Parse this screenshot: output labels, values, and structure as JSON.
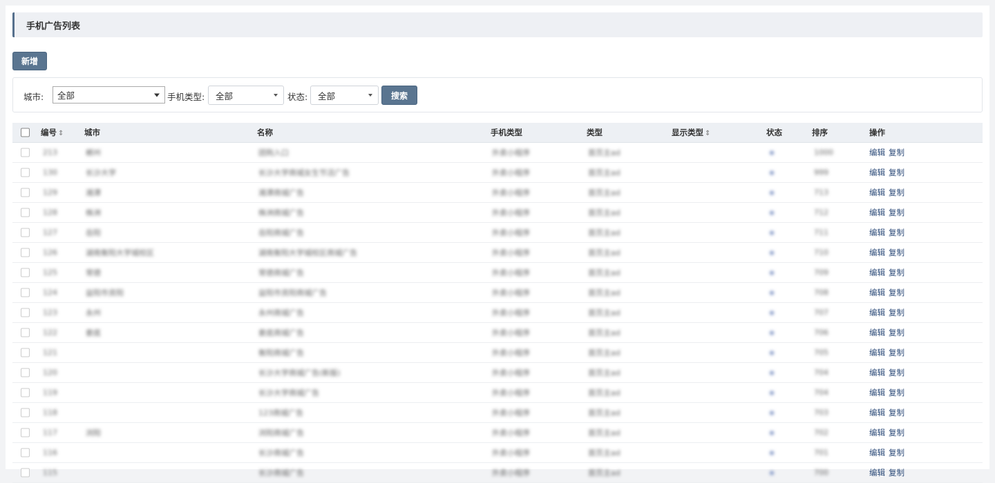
{
  "page": {
    "title": "手机广告列表",
    "add_label": "新增"
  },
  "filters": {
    "city_label": "城市:",
    "city_value": "全部",
    "phone_type_label": "手机类型:",
    "phone_type_value": "全部",
    "status_label": "状态:",
    "status_value": "全部",
    "search_label": "搜索"
  },
  "table": {
    "columns": [
      "编号",
      "城市",
      "名称",
      "手机类型",
      "类型",
      "显示类型",
      "状态",
      "排序",
      "操作"
    ],
    "sort_glyph": "⇕",
    "edit_label": "编辑",
    "copy_label": "复制",
    "rows": [
      {
        "id": "213",
        "city": "郴州",
        "name": "团购入口",
        "phone_type": "外卖小程序",
        "type": "首页主ad",
        "sort": "1000"
      },
      {
        "id": "130",
        "city": "长沙大学",
        "name": "长沙大学商城女生节活广告",
        "phone_type": "外卖小程序",
        "type": "首页主ad",
        "sort": "999"
      },
      {
        "id": "129",
        "city": "湘潭",
        "name": "湘潭商城广告",
        "phone_type": "外卖小程序",
        "type": "首页主ad",
        "sort": "713"
      },
      {
        "id": "128",
        "city": "株洲",
        "name": "株洲商城广告",
        "phone_type": "外卖小程序",
        "type": "首页主ad",
        "sort": "712"
      },
      {
        "id": "127",
        "city": "岳阳",
        "name": "岳阳商城广告",
        "phone_type": "外卖小程序",
        "type": "首页主ad",
        "sort": "711"
      },
      {
        "id": "126",
        "city": "湖南衡阳大学城校区",
        "name": "湖南衡阳大学城校区商城广告",
        "phone_type": "外卖小程序",
        "type": "首页主ad",
        "sort": "710"
      },
      {
        "id": "125",
        "city": "常德",
        "name": "常德商城广告",
        "phone_type": "外卖小程序",
        "type": "首页主ad",
        "sort": "709"
      },
      {
        "id": "124",
        "city": "益阳市资阳",
        "name": "益阳市资阳商城广告",
        "phone_type": "外卖小程序",
        "type": "首页主ad",
        "sort": "708"
      },
      {
        "id": "123",
        "city": "永州",
        "name": "永州商城广告",
        "phone_type": "外卖小程序",
        "type": "首页主ad",
        "sort": "707"
      },
      {
        "id": "122",
        "city": "娄底",
        "name": "娄底商城广告",
        "phone_type": "外卖小程序",
        "type": "首页主ad",
        "sort": "706"
      },
      {
        "id": "121",
        "city": "",
        "name": "衡阳商城广告",
        "phone_type": "外卖小程序",
        "type": "首页主ad",
        "sort": "705"
      },
      {
        "id": "120",
        "city": "",
        "name": "长沙大学商城广告(新版)",
        "phone_type": "外卖小程序",
        "type": "首页主ad",
        "sort": "704"
      },
      {
        "id": "119",
        "city": "",
        "name": "长沙大学商城广告",
        "phone_type": "外卖小程序",
        "type": "首页主ad",
        "sort": "704"
      },
      {
        "id": "118",
        "city": "",
        "name": "123商城广告",
        "phone_type": "外卖小程序",
        "type": "首页主ad",
        "sort": "703"
      },
      {
        "id": "117",
        "city": "浏阳",
        "name": "浏阳商城广告",
        "phone_type": "外卖小程序",
        "type": "首页主ad",
        "sort": "702"
      },
      {
        "id": "116",
        "city": "",
        "name": "长沙商城广告",
        "phone_type": "外卖小程序",
        "type": "首页主ad",
        "sort": "701"
      },
      {
        "id": "115",
        "city": "",
        "name": "长沙商城广告",
        "phone_type": "外卖小程序",
        "type": "首页主ad",
        "sort": "700"
      }
    ]
  }
}
